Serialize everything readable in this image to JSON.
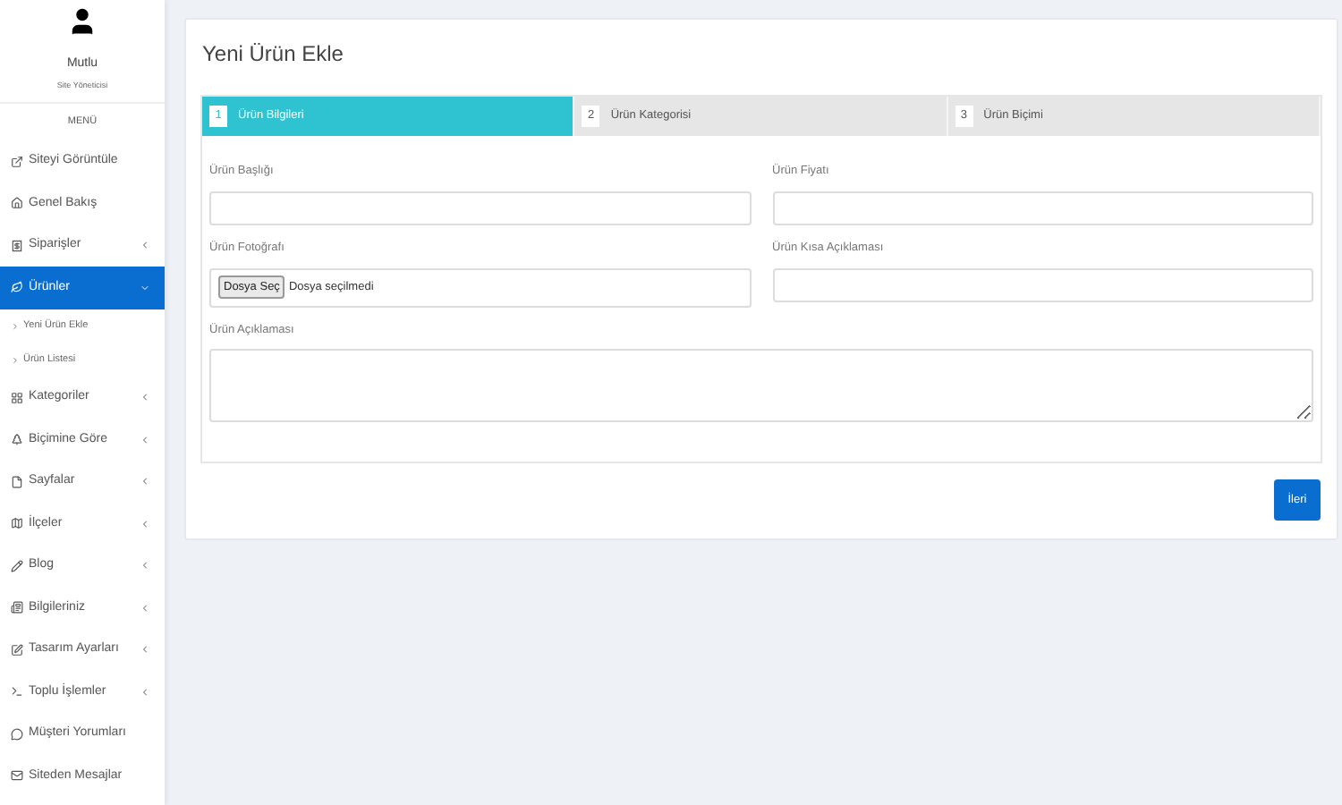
{
  "sidebar": {
    "user": {
      "name": "Mutlu",
      "role": "Site Yöneticisi"
    },
    "menu_heading": "MENÜ",
    "items": [
      {
        "label": "Siteyi Görüntüle",
        "kind": "link",
        "selected": false
      },
      {
        "label": "Genel Bakış",
        "kind": "link",
        "selected": false
      },
      {
        "label": "Siparişler",
        "kind": "group",
        "expanded": false,
        "selected": false
      },
      {
        "label": "Ürünler",
        "kind": "group",
        "expanded": true,
        "selected": true,
        "children": [
          {
            "label": "Yeni Ürün Ekle",
            "selected": false
          },
          {
            "label": "Ürün Listesi",
            "selected": false
          }
        ]
      },
      {
        "label": "Kategoriler",
        "kind": "group",
        "expanded": false,
        "selected": false
      },
      {
        "label": "Biçimine Göre",
        "kind": "group",
        "expanded": false,
        "selected": false
      },
      {
        "label": "Sayfalar",
        "kind": "group",
        "expanded": false,
        "selected": false
      },
      {
        "label": "İlçeler",
        "kind": "group",
        "expanded": false,
        "selected": false
      },
      {
        "label": "Blog",
        "kind": "group",
        "expanded": false,
        "selected": false
      },
      {
        "label": "Bilgileriniz",
        "kind": "group",
        "expanded": false,
        "selected": false
      },
      {
        "label": "Tasarım Ayarları",
        "kind": "group",
        "expanded": false,
        "selected": false
      },
      {
        "label": "Toplu İşlemler",
        "kind": "group",
        "expanded": false,
        "selected": false
      },
      {
        "label": "Müşteri Yorumları",
        "kind": "link",
        "selected": false
      },
      {
        "label": "Siteden Mesajlar",
        "kind": "link",
        "selected": false
      }
    ]
  },
  "page": {
    "title": "Yeni Ürün Ekle",
    "steps": [
      {
        "number": "1",
        "label": "Ürün Bilgileri",
        "selected": true
      },
      {
        "number": "2",
        "label": "Ürün Kategorisi",
        "selected": false
      },
      {
        "number": "3",
        "label": "Ürün Biçimi",
        "selected": false
      }
    ],
    "fields": [
      {
        "label": "Ürün Başlığı",
        "kind": "text"
      },
      {
        "label": "Ürün Fiyatı",
        "kind": "text"
      },
      {
        "label": "Ürün Fotoğrafı",
        "kind": "file",
        "button": "Dosya Seç",
        "value": "Dosya seçilmedi"
      },
      {
        "label": "Ürün Kısa Açıklaması",
        "kind": "text"
      },
      {
        "label": "Ürün Açıklaması",
        "kind": "textarea"
      }
    ],
    "next_button": "İleri"
  }
}
